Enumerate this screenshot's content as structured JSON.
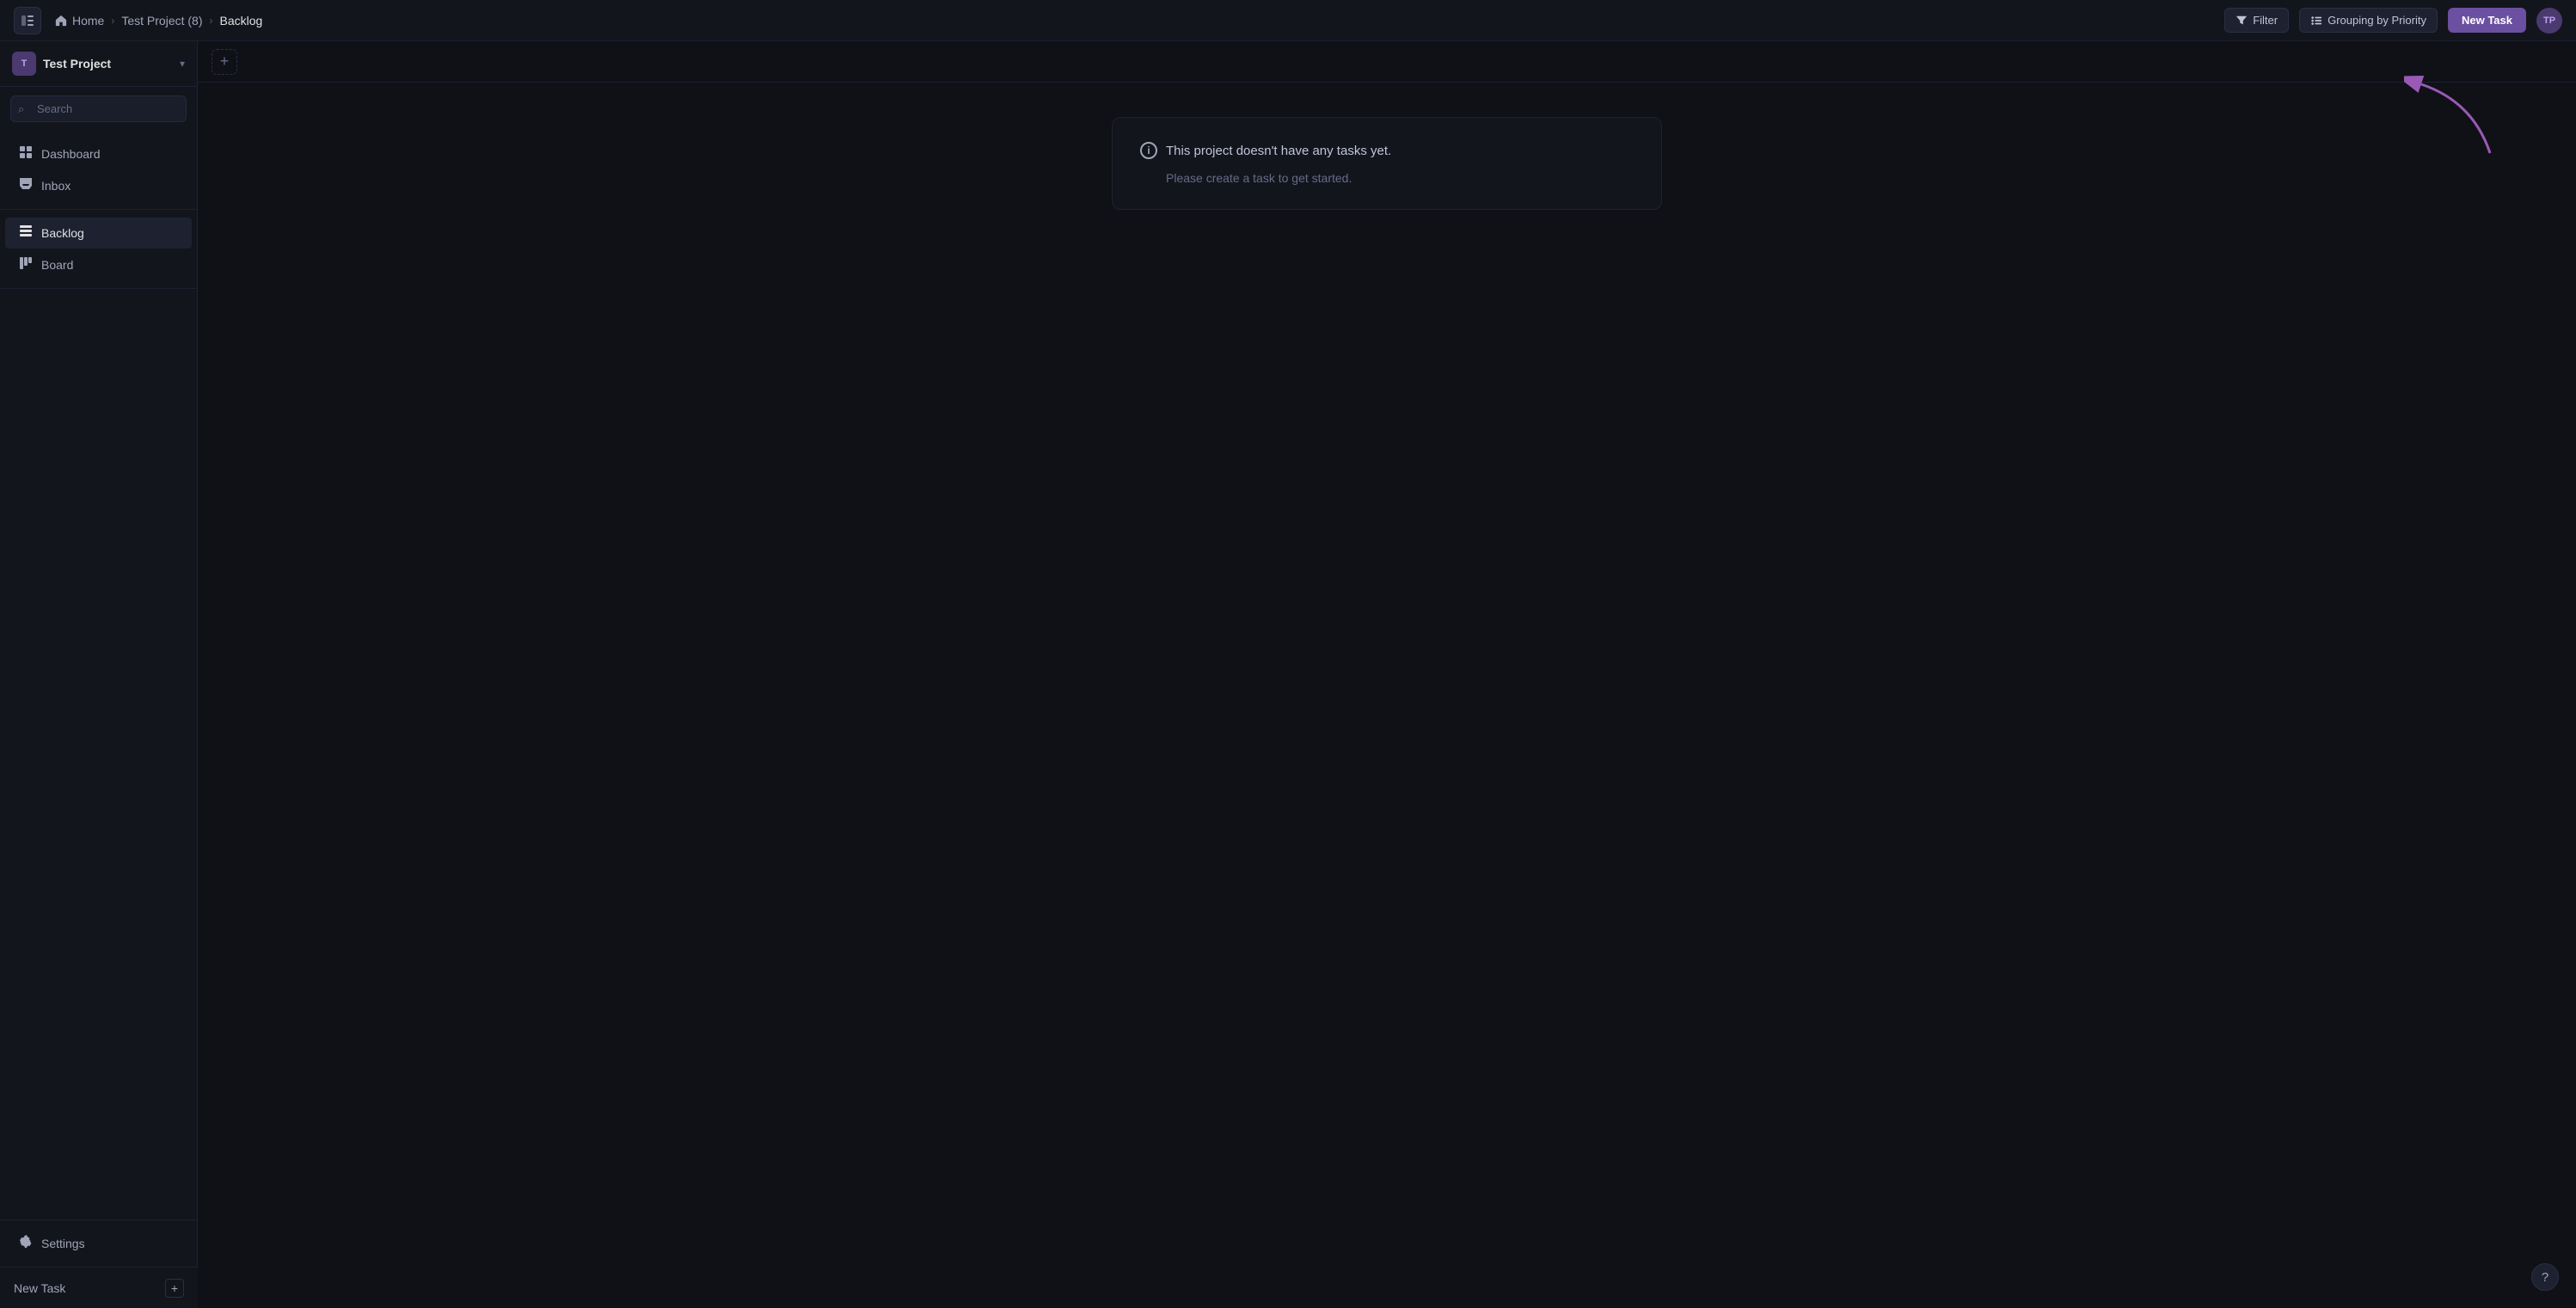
{
  "topNav": {
    "sidebarToggleIcon": "sidebar-icon",
    "homeLabel": "Home",
    "homeIcon": "home-icon",
    "breadcrumbs": [
      {
        "label": "Home",
        "active": false
      },
      {
        "label": "Test Project (8)",
        "active": false
      },
      {
        "label": "Backlog",
        "active": true
      }
    ],
    "filterLabel": "Filter",
    "filterIcon": "filter-icon",
    "groupingLabel": "Grouping by Priority",
    "groupingIcon": "grouping-icon",
    "newTaskLabel": "New Task",
    "avatarInitials": "TP"
  },
  "sidebar": {
    "projectName": "Test Project",
    "projectInitials": "T",
    "searchPlaceholder": "Search",
    "items": [
      {
        "id": "dashboard",
        "label": "Dashboard",
        "icon": "dashboard-icon",
        "active": false
      },
      {
        "id": "inbox",
        "label": "Inbox",
        "icon": "inbox-icon",
        "active": false
      },
      {
        "id": "backlog",
        "label": "Backlog",
        "icon": "backlog-icon",
        "active": true
      },
      {
        "id": "board",
        "label": "Board",
        "icon": "board-icon",
        "active": false
      }
    ],
    "bottomItems": [
      {
        "id": "settings",
        "label": "Settings",
        "icon": "settings-icon",
        "active": false
      }
    ]
  },
  "bottomBar": {
    "newTaskLabel": "New Task",
    "plusIcon": "plus-icon"
  },
  "contentArea": {
    "addButtonIcon": "plus-icon",
    "emptyState": {
      "infoIcon": "info-icon",
      "title": "This project doesn't have any tasks yet.",
      "subtitle": "Please create a task to get started."
    }
  },
  "helpBtn": {
    "label": "?",
    "icon": "help-icon"
  },
  "arrow": {
    "color": "#9b59b6"
  }
}
